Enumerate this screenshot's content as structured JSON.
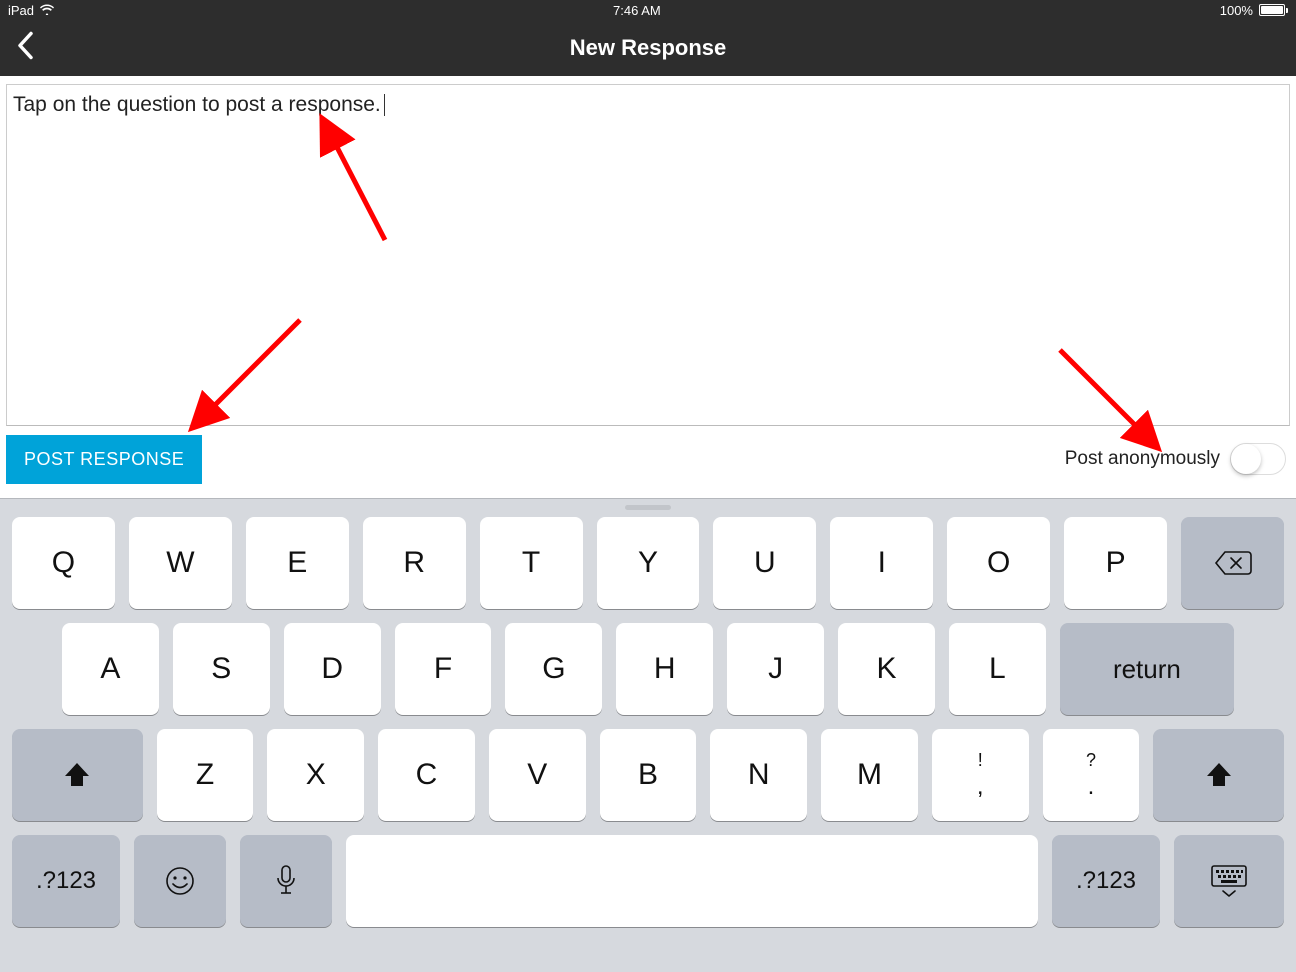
{
  "status": {
    "device": "iPad",
    "time": "7:46 AM",
    "battery_pct": "100%"
  },
  "nav": {
    "title": "New Response"
  },
  "compose": {
    "text": "Tap on the question to post a response.",
    "post_button": "POST RESPONSE",
    "anon_label": "Post anonymously",
    "anon_on": false
  },
  "keyboard": {
    "row1": [
      "Q",
      "W",
      "E",
      "R",
      "T",
      "Y",
      "U",
      "I",
      "O",
      "P"
    ],
    "row2": [
      "A",
      "S",
      "D",
      "F",
      "G",
      "H",
      "J",
      "K",
      "L"
    ],
    "row3": [
      "Z",
      "X",
      "C",
      "V",
      "B",
      "N",
      "M"
    ],
    "punct1_top": "!",
    "punct1_bot": ",",
    "punct2_top": "?",
    "punct2_bot": ".",
    "return": "return",
    "numkey": ".?123"
  }
}
